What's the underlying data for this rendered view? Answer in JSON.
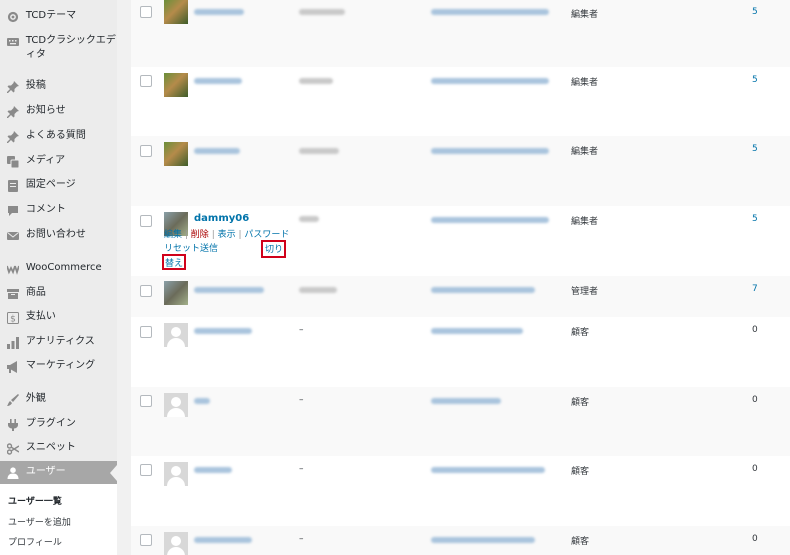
{
  "sidebar": {
    "items": [
      {
        "label": "TCDテーマ",
        "icon": "gear-icon"
      },
      {
        "label": "TCDクラシックエディタ",
        "icon": "keyboard-icon"
      },
      {
        "label": "投稿",
        "icon": "pin-icon"
      },
      {
        "label": "お知らせ",
        "icon": "pin-icon"
      },
      {
        "label": "よくある質問",
        "icon": "pin-icon"
      },
      {
        "label": "メディア",
        "icon": "media-icon"
      },
      {
        "label": "固定ページ",
        "icon": "page-icon"
      },
      {
        "label": "コメント",
        "icon": "comment-icon"
      },
      {
        "label": "お問い合わせ",
        "icon": "mail-icon"
      },
      {
        "label": "WooCommerce",
        "icon": "woo-icon"
      },
      {
        "label": "商品",
        "icon": "archive-icon"
      },
      {
        "label": "支払い",
        "icon": "dollar-icon"
      },
      {
        "label": "アナリティクス",
        "icon": "chart-icon"
      },
      {
        "label": "マーケティング",
        "icon": "megaphone-icon"
      },
      {
        "label": "外観",
        "icon": "brush-icon"
      },
      {
        "label": "プラグイン",
        "icon": "plugin-icon"
      },
      {
        "label": "スニペット",
        "icon": "scissors-icon"
      },
      {
        "label": "ユーザー",
        "icon": "user-icon"
      }
    ],
    "submenu": [
      "ユーザー一覧",
      "ユーザーを追加",
      "プロフィール"
    ]
  },
  "rows": [
    {
      "role": "編集者",
      "posts": "5"
    },
    {
      "role": "編集者",
      "posts": "5"
    },
    {
      "role": "編集者",
      "posts": "5"
    },
    {
      "username": "dammy06",
      "role": "編集者",
      "posts": "5",
      "actions": {
        "edit": "編集",
        "delete": "削除",
        "view": "表示",
        "reset": "パスワードリセット送信",
        "switch_a": "切り",
        "switch_b": "替え"
      }
    },
    {
      "role": "管理者",
      "posts": "7"
    },
    {
      "dash": "–",
      "role": "顧客",
      "posts": "0"
    },
    {
      "dash": "–",
      "role": "顧客",
      "posts": "0"
    },
    {
      "dash": "–",
      "role": "顧客",
      "posts": "0"
    },
    {
      "dash": "–",
      "role": "顧客",
      "posts": "0"
    }
  ],
  "colors": {
    "link": "#0073aa",
    "highlight": "#d0021b",
    "active_menu": "#a7a7a7"
  }
}
